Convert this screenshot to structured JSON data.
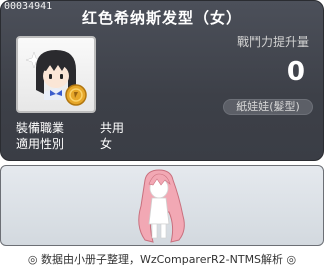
{
  "item_id": "00034941",
  "title": "红色希纳斯发型（女）",
  "attack": {
    "label": "戰鬥力提升量",
    "value": "0"
  },
  "category": "紙娃娃(髮型)",
  "info": [
    {
      "label": "裝備職業",
      "value": "共用"
    },
    {
      "label": "適用性別",
      "value": "女"
    }
  ],
  "footer": "◎ 数据由小册子整理，WzComparerR2-NTMS解析 ◎",
  "colors": {
    "panel_bg": "#3d4048",
    "preview_bg": "#dde2e8",
    "hair_pink": "#f2a8b4"
  },
  "icons": {
    "item_icon": "female-character-with-coin-icon",
    "preview_figure": "pink-hair-character-preview"
  }
}
